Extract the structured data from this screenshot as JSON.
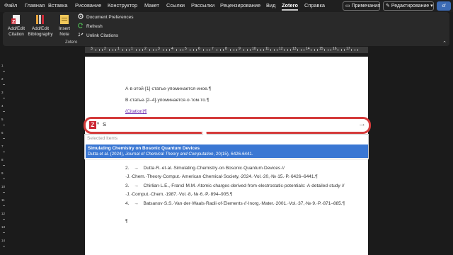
{
  "menubar": {
    "tabs": [
      "Файл",
      "Главная",
      "Вставка",
      "Рисование",
      "Конструктор",
      "Макет",
      "Ссылки",
      "Рассылки",
      "Рецензирование",
      "Вид",
      "Zotero",
      "Справка"
    ],
    "active_tab": "Zotero",
    "notes_button": "Примечания",
    "edit_button": "Редактирование",
    "avatar": "cf"
  },
  "ribbon": {
    "add_edit_citation": "Add/Edit Citation",
    "add_edit_bibliography": "Add/Edit Bibliography",
    "insert_note": "Insert Note",
    "document_preferences": "Document Preferences",
    "refresh": "Refresh",
    "unlink_citations": "Unlink Citations",
    "group_label": "Zotero"
  },
  "ruler": {
    "numbers": [
      "3",
      "2",
      "1",
      "1",
      "2",
      "3",
      "4",
      "5",
      "6",
      "7",
      "8",
      "9",
      "10",
      "11",
      "12",
      "13",
      "14",
      "15",
      "16",
      "17"
    ]
  },
  "vruler": {
    "numbers": [
      "1",
      "2",
      "3",
      "4",
      "5",
      "6",
      "7",
      "8",
      "9",
      "10",
      "11",
      "12",
      "13",
      "14"
    ]
  },
  "document": {
    "line1": "А·в·этой·[1]·статье·упоминается·иное.¶",
    "line2": "В·статье·[2–4]·упоминается·о·том·то.¶",
    "line3": "{Citation}¶",
    "bib2_num": "2.",
    "bib2_text": "Dutta·R.·et·al.·Simulating·Chemistry·on·Bosonic·Quantum·Devices·//·J.·Chem.·Theory·Comput.·American·Chemical·Society,·2024.·Vol.·20,·№·15.·P.·6426–6441.¶",
    "bib3_num": "3.",
    "bib3_text": "Chirlian·L.E.,·Francl·M.M.·Atomic·charges·derived·from·electrostatic·potentials:·A·detailed·study·//·J.·Comput.·Chem.·1987.·Vol.·8,·№·6.·P.·894–905.¶",
    "bib4_num": "4.",
    "bib4_text": "Batsanov·S.S.·Van·der·Waals·Radii·of·Elements·//·Inorg.·Mater.·2001.·Vol.·37,·№·9.·P.·871–885.¶",
    "empty_para": "¶",
    "arrow": "→"
  },
  "zotero_dialog": {
    "query": "S",
    "section_header": "Selected Items",
    "result_title": "Simulating Chemistry on Bosonic Quantum Devices",
    "result_authors": "Dutta et al. (2024), ",
    "result_journal": "Journal of Chemical Theory and Computation",
    "result_details": ", 20(15), 6426-6441."
  },
  "colors": {
    "accent_red": "#d43b3b",
    "zotero_red": "#cc2936",
    "selection_blue": "#3a77d3",
    "citation_purple": "#6b2ab0"
  }
}
